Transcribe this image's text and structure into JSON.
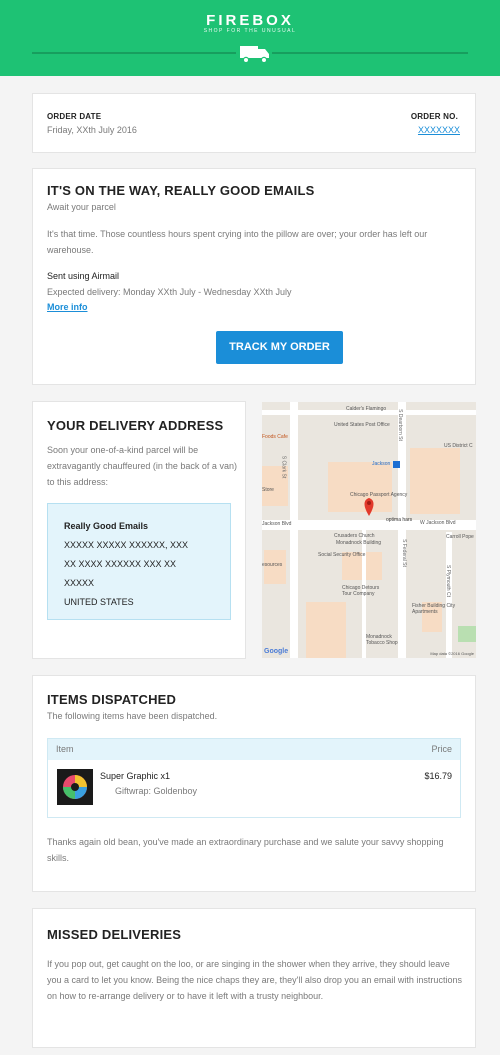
{
  "header": {
    "brand": "FIREBOX",
    "tagline": "SHOP FOR THE UNUSUAL",
    "icon": "delivery-van-icon"
  },
  "order": {
    "date_label": "ORDER DATE",
    "date_value": "Friday, XXth July 2016",
    "number_label": "ORDER NO.",
    "number_value": "XXXXXXX"
  },
  "shipping": {
    "title": "IT'S ON THE WAY, REALLY GOOD EMAILS",
    "subtitle": "Await your parcel",
    "message": "It's that time. Those countless hours spent crying into the pillow are over; your order has left our warehouse.",
    "method": "Sent using Airmail",
    "expected": "Expected delivery: Monday XXth July - Wednesday XXth July",
    "more_info": "More info",
    "track_button": "TRACK MY ORDER"
  },
  "address": {
    "title": "YOUR DELIVERY ADDRESS",
    "intro": "Soon your one-of-a-kind parcel will be extravagantly chauffeured (in the back of a van) to this address:",
    "name": "Really Good Emails",
    "line1": "XXXXX XXXXX XXXXXX, XXX",
    "line2": "XX XXXX XXXXXX XXX XX",
    "line3": "XXXXX",
    "country": "UNITED STATES"
  },
  "map": {
    "labels": {
      "l1": "Calder's Flamingo",
      "l2": "United States Post Office",
      "l3": "Jackson",
      "l4": "US District C",
      "l5": "Chicago Passport Agency",
      "l6": "optima hars",
      "l7": "W Jackson Blvd",
      "l8": "Crusaders Church",
      "l9": "Monadnock Building",
      "l10": "Social Security Office",
      "l11": "Chicago Detours Tour Company",
      "l12": "Fisher Building City Apartments",
      "l13": "Monadnock Tobacco Shop",
      "l14": "Carroll Pope",
      "l15": "Google",
      "l16": "Map data ©2016 Google",
      "street1": "S Clark St",
      "street2": "S Dearborn St",
      "street3": "S Plymouth Ct",
      "street4": "S Federal St",
      "street5": "Jackson Blvd",
      "l17": "Store",
      "l18": "Foods Cafe",
      "l19": "esources"
    }
  },
  "items": {
    "title": "ITEMS DISPATCHED",
    "subtitle": "The following items have been dispatched.",
    "col_item": "Item",
    "col_price": "Price",
    "rows": [
      {
        "name": "Super Graphic x1",
        "detail": "Giftwrap: Goldenboy",
        "price": "$16.79"
      }
    ],
    "thanks": "Thanks again old bean, you've made an extraordinary purchase and we salute your savvy shopping skills."
  },
  "missed": {
    "title": "MISSED DELIVERIES",
    "text": "If you pop out, get caught on the loo, or are singing in the shower when they arrive, they should leave you a card to let you know. Being the nice chaps they are, they'll also drop you an email with instructions on how to re-arrange delivery or to have it left with a trusty neighbour."
  },
  "colors": {
    "brand_green": "#1ec274",
    "link_blue": "#1b8ed8",
    "panel_blue": "#e3f4fb"
  }
}
